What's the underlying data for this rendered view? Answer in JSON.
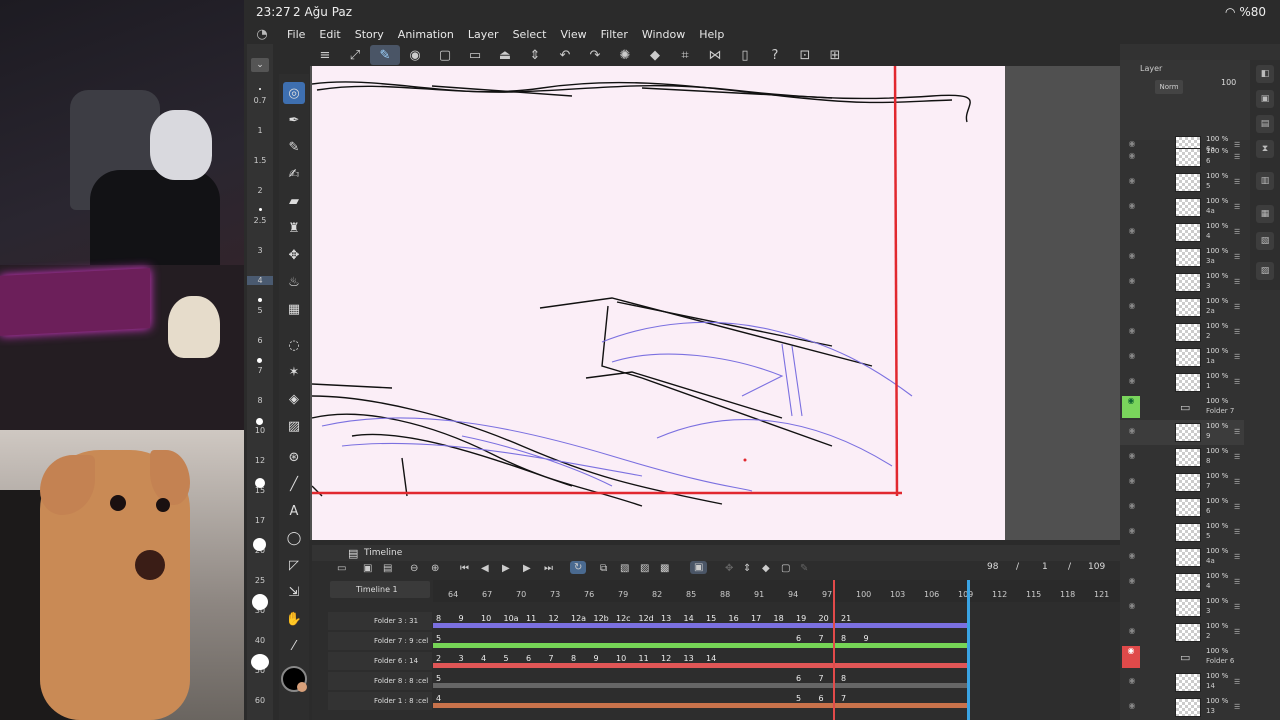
{
  "status": {
    "time": "23:27",
    "date": "2 Ağu Paz",
    "battery": "%80"
  },
  "menu": [
    "File",
    "Edit",
    "Story",
    "Animation",
    "Layer",
    "Select",
    "View",
    "Filter",
    "Window",
    "Help"
  ],
  "brush_sizes": [
    "0.7",
    "1",
    "1.5",
    "2",
    "2.5",
    "3",
    "4",
    "5",
    "6",
    "7",
    "8",
    "10",
    "12",
    "15",
    "17",
    "20",
    "25",
    "30",
    "40",
    "50",
    "60"
  ],
  "layers_panel": {
    "tab_label": "Layer",
    "opacity": "100",
    "blend": "Norm",
    "rows": [
      {
        "pct": "100 %",
        "name": "6a"
      },
      {
        "pct": "100 %",
        "name": "6"
      },
      {
        "pct": "100 %",
        "name": "5"
      },
      {
        "pct": "100 %",
        "name": "4a"
      },
      {
        "pct": "100 %",
        "name": "4"
      },
      {
        "pct": "100 %",
        "name": "3a"
      },
      {
        "pct": "100 %",
        "name": "3"
      },
      {
        "pct": "100 %",
        "name": "2a"
      },
      {
        "pct": "100 %",
        "name": "2"
      },
      {
        "pct": "100 %",
        "name": "1a"
      },
      {
        "pct": "100 %",
        "name": "1"
      },
      {
        "pct": "100 %",
        "name": "Folder 7",
        "folder": "green"
      },
      {
        "pct": "100 %",
        "name": "9",
        "selected": true
      },
      {
        "pct": "100 %",
        "name": "8"
      },
      {
        "pct": "100 %",
        "name": "7"
      },
      {
        "pct": "100 %",
        "name": "6"
      },
      {
        "pct": "100 %",
        "name": "5"
      },
      {
        "pct": "100 %",
        "name": "4a"
      },
      {
        "pct": "100 %",
        "name": "4"
      },
      {
        "pct": "100 %",
        "name": "3"
      },
      {
        "pct": "100 %",
        "name": "2"
      },
      {
        "pct": "100 %",
        "name": "Folder 6",
        "folder": "red"
      },
      {
        "pct": "100 %",
        "name": "14"
      },
      {
        "pct": "100 %",
        "name": "13"
      }
    ]
  },
  "timeline": {
    "panel_title": "Timeline",
    "name": "Timeline 1",
    "current_frame": "98",
    "start": "1",
    "end": "109",
    "ruler": [
      "64",
      "67",
      "70",
      "73",
      "76",
      "79",
      "82",
      "85",
      "88",
      "91",
      "94",
      "97",
      "100",
      "103",
      "106",
      "109",
      "112",
      "115",
      "118",
      "121"
    ],
    "tracks": [
      {
        "label": "Folder 3 : 31 :cel",
        "color": "#7b70e0",
        "cells": [
          "8",
          "9",
          "10",
          "10a",
          "11",
          "12",
          "12a",
          "12b",
          "12c",
          "12d",
          "13",
          "14",
          "15",
          "16",
          "17",
          "18",
          "19",
          "20",
          "21"
        ]
      },
      {
        "label": "Folder 7 : 9 :cel",
        "color": "#76d456",
        "cells": [
          "5",
          "",
          "",
          "",
          "",
          "",
          "",
          "",
          "",
          "",
          "",
          "",
          "",
          "",
          "",
          "",
          "6",
          "7",
          "8",
          "9"
        ]
      },
      {
        "label": "Folder 6 : 14 :cel",
        "color": "#e05656",
        "cells": [
          "2",
          "3",
          "4",
          "5",
          "6",
          "7",
          "8",
          "9",
          "10",
          "11",
          "12",
          "13",
          "14"
        ]
      },
      {
        "label": "Folder 8 : 8 :cel",
        "color": "#555555",
        "cells": [
          "5",
          "",
          "",
          "",
          "",
          "",
          "",
          "",
          "",
          "",
          "",
          "",
          "",
          "",
          "",
          "",
          "6",
          "7",
          "8"
        ]
      },
      {
        "label": "Folder 1 : 8 :cel",
        "color": "#c8724b",
        "cells": [
          "4",
          "",
          "",
          "",
          "",
          "",
          "",
          "",
          "",
          "",
          "",
          "",
          "",
          "",
          "",
          "",
          "5",
          "6",
          "7"
        ]
      }
    ]
  }
}
